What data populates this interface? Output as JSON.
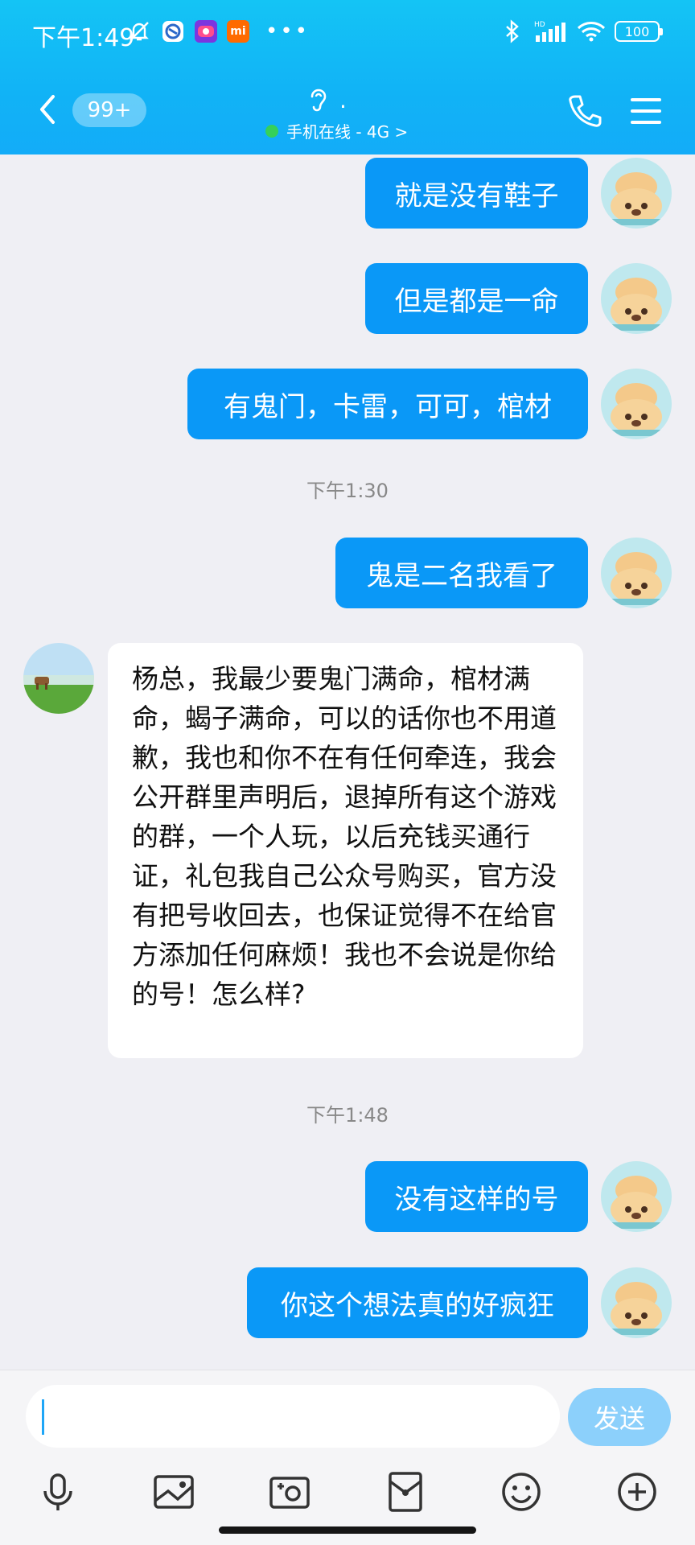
{
  "status_bar": {
    "time": "下午1:49",
    "mi_badge": "mi",
    "battery": "100"
  },
  "nav": {
    "unread_count": "99+",
    "contact_name": ".",
    "online_status": "手机在线 - 4G >"
  },
  "messages": [
    {
      "type": "out",
      "text": "就是没有鞋子"
    },
    {
      "type": "out",
      "text": "但是都是一命"
    },
    {
      "type": "out",
      "text": "有鬼门，卡雷，可可，棺材"
    },
    {
      "type": "time",
      "text": "下午1:30"
    },
    {
      "type": "out",
      "text": "鬼是二名我看了"
    },
    {
      "type": "in",
      "text": "杨总，我最少要鬼门满命，棺材满命，蝎子满命，可以的话你也不用道歉，我也和你不在有任何牵连，我会公开群里声明后，退掉所有这个游戏的群，一个人玩，以后充钱买通行证，礼包我自己公众号购买，官方没有把号收回去，也保证觉得不在给官方添加任何麻烦！我也不会说是你给的号！怎么样?"
    },
    {
      "type": "time",
      "text": "下午1:48"
    },
    {
      "type": "out",
      "text": "没有这样的号"
    },
    {
      "type": "out",
      "text": "你这个想法真的好疯狂"
    }
  ],
  "input": {
    "value": "",
    "send_label": "发送"
  },
  "toolbar": {
    "icons": [
      "microphone-icon",
      "image-icon",
      "camera-icon",
      "red-packet-icon",
      "emoji-icon",
      "plus-icon"
    ]
  },
  "colors": {
    "header": "#11b3f6",
    "bubble_out": "#0a98f7",
    "send_button": "#8cd0fb"
  }
}
